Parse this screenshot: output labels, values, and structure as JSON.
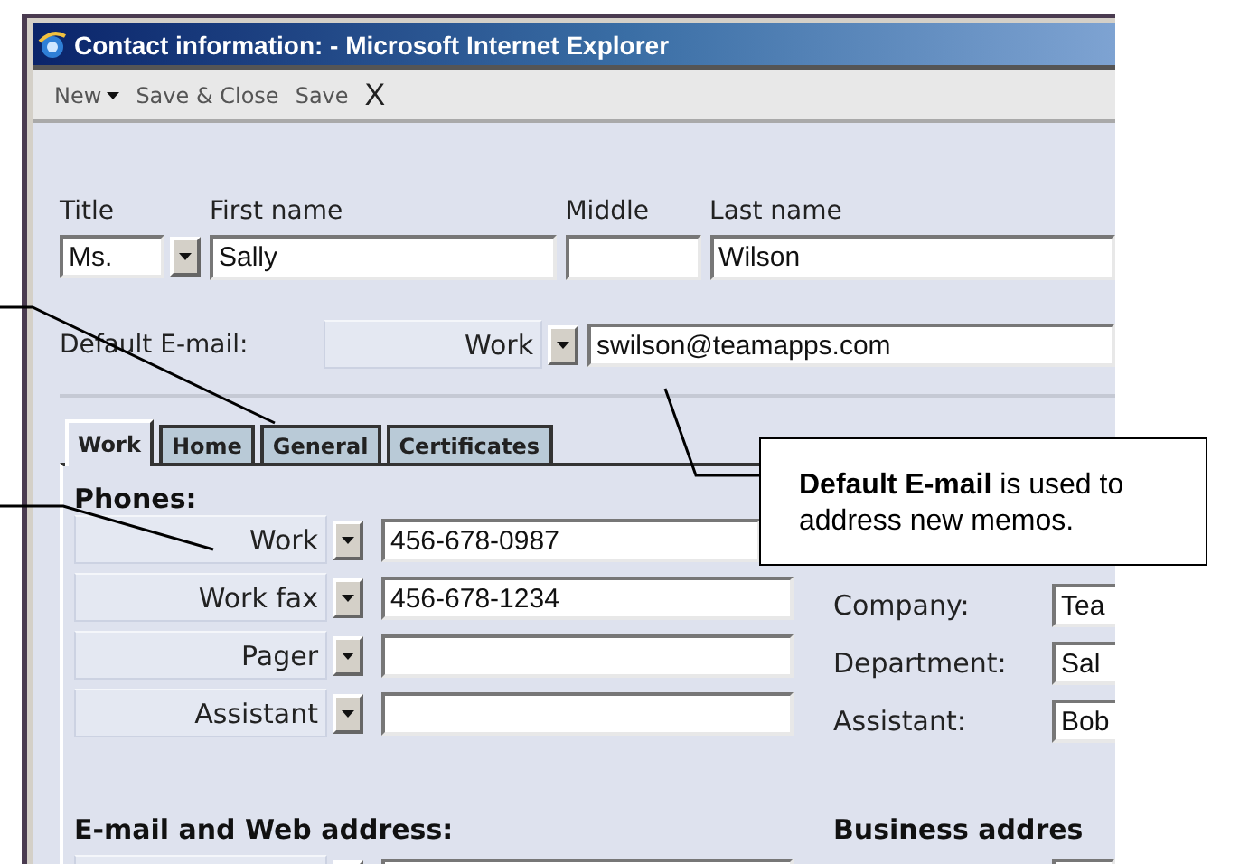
{
  "window": {
    "title": "Contact information: - Microsoft Internet Explorer"
  },
  "toolbar": [
    {
      "label": "New",
      "kind": "menu"
    },
    {
      "label": "Save & Close",
      "kind": "button"
    },
    {
      "label": "Save",
      "kind": "button"
    },
    {
      "label": "X",
      "kind": "close"
    }
  ],
  "name_fields": [
    {
      "label": "Title",
      "value": "Ms.",
      "kind": "select"
    },
    {
      "label": "First name",
      "value": "Sally",
      "kind": "text"
    },
    {
      "label": "Middle",
      "kind": "text"
    },
    {
      "label": "Last name",
      "value": "Wilson",
      "kind": "text"
    }
  ],
  "default_email": {
    "label": "Default E-mail:",
    "type": "Work",
    "value": "swilson@teamapps.com"
  },
  "tabs": [
    {
      "label": "Work",
      "selected": true
    },
    {
      "label": "Home",
      "selected": false
    },
    {
      "label": "General",
      "selected": false
    },
    {
      "label": "Certificates",
      "selected": false
    }
  ],
  "phones": {
    "heading": "Phones:",
    "rows": [
      {
        "type": "Work",
        "value": "456-678-0987"
      },
      {
        "type": "Work fax",
        "value": "456-678-1234"
      },
      {
        "type": "Pager"
      },
      {
        "type": "Assistant"
      }
    ]
  },
  "company_fields": [
    {
      "label": "Company:",
      "value": "Tea"
    },
    {
      "label": "Department:",
      "value": "Sal"
    },
    {
      "label": "Assistant:",
      "value": "Bob"
    }
  ],
  "email_section": {
    "heading": "E-mail and Web address:"
  },
  "business_section": {
    "heading": "Business addres"
  },
  "callout": {
    "text": "**Default E-mail** is used to address new memos."
  }
}
